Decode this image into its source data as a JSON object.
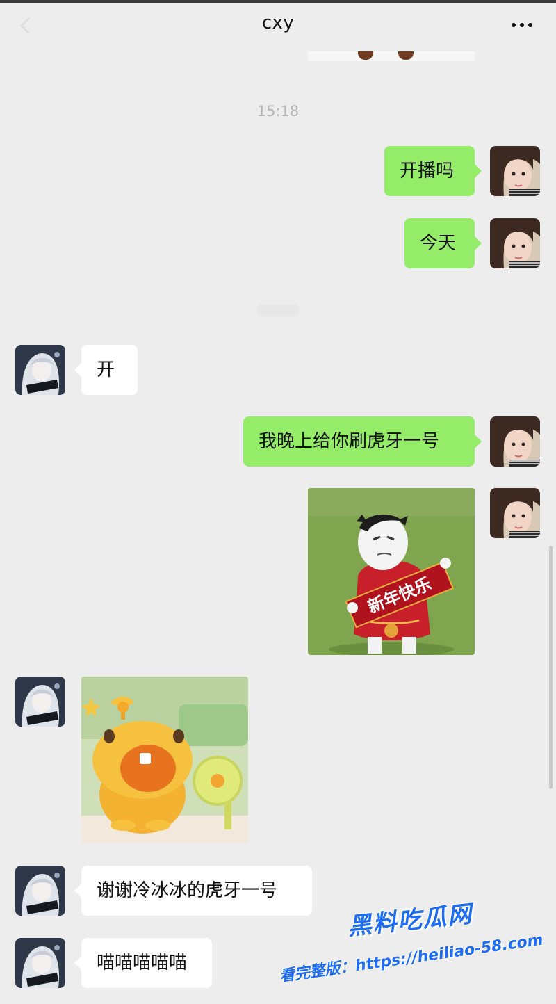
{
  "header": {
    "title": "cxy",
    "back_icon": "chevron-left-icon",
    "more_icon": "more-dots-icon"
  },
  "timestamp": "15:18",
  "messages": [
    {
      "side": "me",
      "type": "text",
      "text": "开播吗"
    },
    {
      "side": "me",
      "type": "text",
      "text": "今天"
    },
    {
      "side": "other",
      "type": "text",
      "text": "开"
    },
    {
      "side": "me",
      "type": "text",
      "text": "我晚上给你刷虎牙一号"
    },
    {
      "side": "me",
      "type": "sticker",
      "sticker": "cow-new-year-sticker",
      "sticker_text": "新年快乐"
    },
    {
      "side": "other",
      "type": "sticker",
      "sticker": "yellow-creature-sticker"
    },
    {
      "side": "other",
      "type": "text",
      "text": "谢谢冷冰冰的虎牙一号"
    },
    {
      "side": "other",
      "type": "text",
      "text": "喵喵喵喵喵"
    }
  ],
  "watermark": {
    "brand": "黑料吃瓜网",
    "url": "看完整版：https://heiliao-58.com"
  },
  "colors": {
    "background": "#ededed",
    "my_bubble": "#95ec69",
    "other_bubble": "#ffffff",
    "timestamp": "#b4b4b4",
    "watermark": "#1d6cf2"
  }
}
